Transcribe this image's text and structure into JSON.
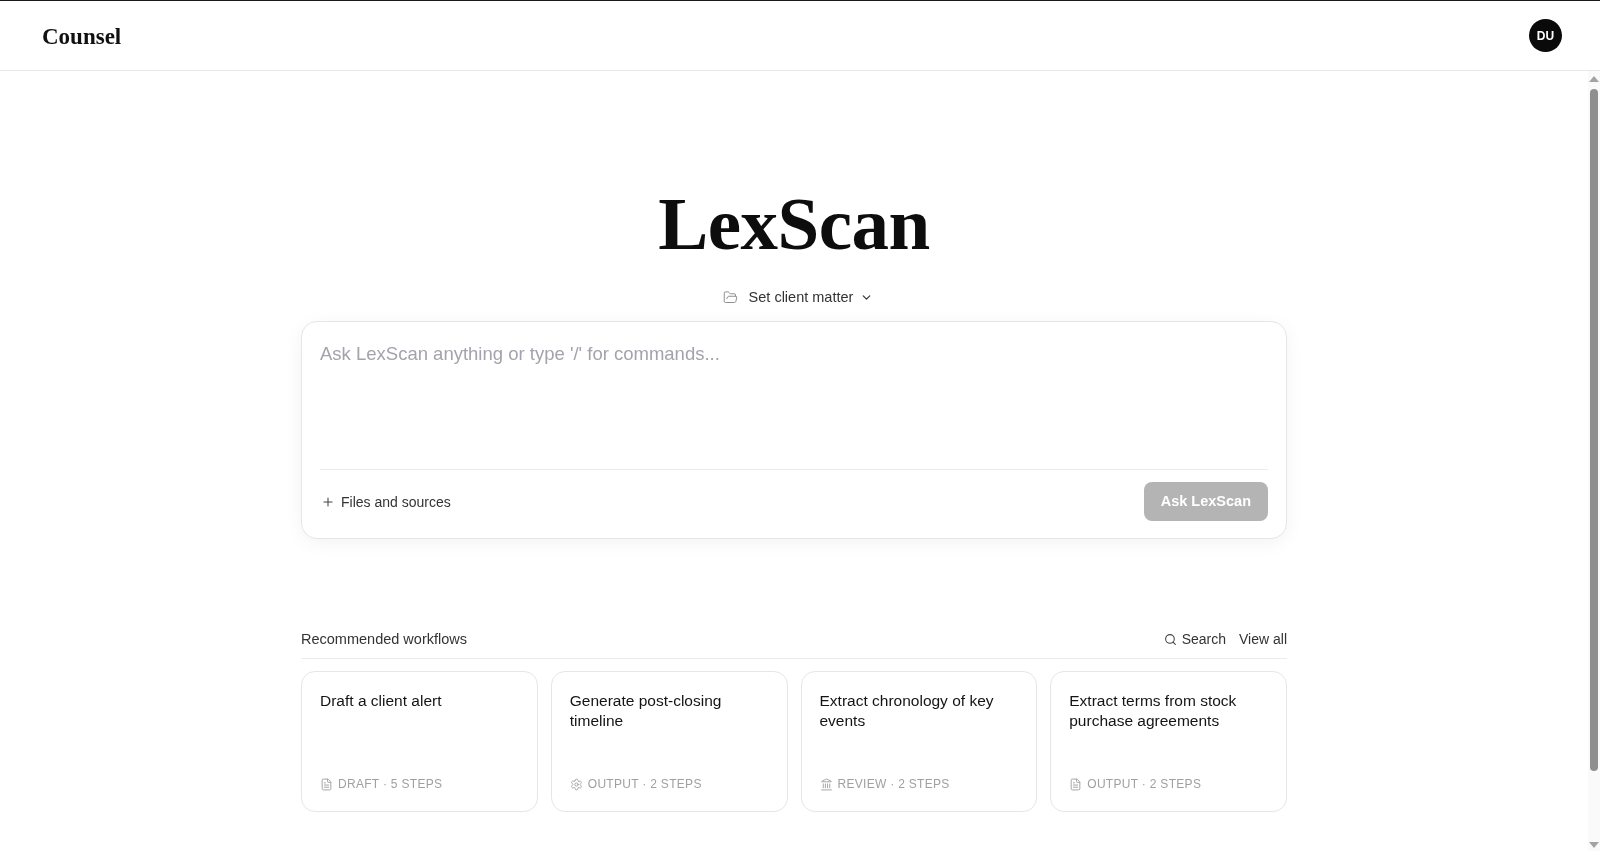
{
  "header": {
    "logo": "Counsel",
    "avatar_initials": "DU"
  },
  "hero": {
    "title": "LexScan",
    "client_matter": {
      "label": "Set client matter"
    }
  },
  "composer": {
    "placeholder": "Ask LexScan anything or type '/' for commands...",
    "attach_label": "Files and sources",
    "submit": {
      "label": "Ask LexScan",
      "disabled": true
    }
  },
  "workflows": {
    "heading": "Recommended workflows",
    "actions": [
      {
        "kind": "search",
        "label": "Search"
      },
      {
        "kind": "link",
        "label": "View all"
      }
    ],
    "cards": [
      {
        "title": "Draft a client alert",
        "kind": "document",
        "meta": "DRAFT · 5 STEPS"
      },
      {
        "title": "Generate post-closing timeline",
        "kind": "gear",
        "meta": "OUTPUT · 2 STEPS"
      },
      {
        "title": "Extract chronology of key events",
        "kind": "building",
        "meta": "REVIEW · 2 STEPS"
      },
      {
        "title": "Extract terms from stock purchase agreements",
        "kind": "document",
        "meta": "OUTPUT · 2 STEPS"
      }
    ]
  }
}
